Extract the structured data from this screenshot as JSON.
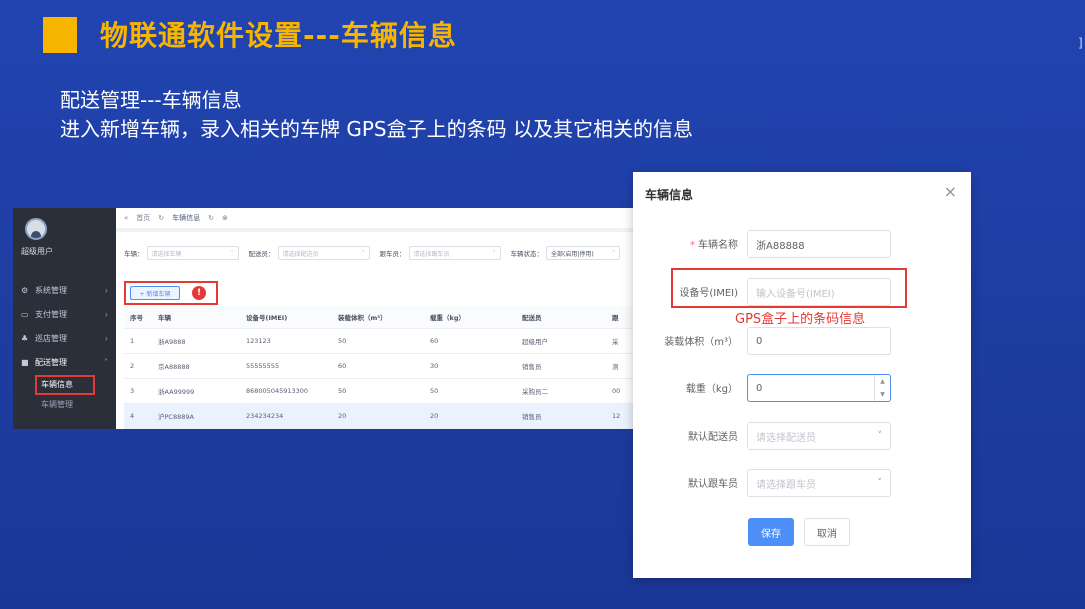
{
  "slide": {
    "title": "物联通软件设置---车辆信息",
    "line1": "配送管理---车辆信息",
    "line2": "进入新增车辆，录入相关的车牌   GPS盒子上的条码  以及其它相关的信息",
    "edge_mark": "]",
    "accent_color": "#f7b500",
    "background_color": "#1f3fa8"
  },
  "admin": {
    "user_name": "超级用户",
    "topbar": {
      "collapse_icon": "double-chevron-left-icon",
      "home_tab": "首页",
      "active_tab": "车辆信息"
    },
    "menu": [
      {
        "icon": "gear-icon",
        "label": "系统管理"
      },
      {
        "icon": "card-icon",
        "label": "支付管理"
      },
      {
        "icon": "tree-icon",
        "label": "巡店管理"
      },
      {
        "icon": "truck-icon",
        "label": "配送管理"
      }
    ],
    "submenu": [
      {
        "label": "车辆信息"
      },
      {
        "label": "车辆管理"
      }
    ],
    "filters": {
      "vehicle_label": "车辆：",
      "vehicle_ph": "请选择车辆",
      "dispatcher_label": "配送员：",
      "dispatcher_ph": "请选择配送员",
      "follower_label": "跟车员：",
      "follower_ph": "请选择跟车员",
      "status_label": "车辆状态：",
      "status_value": "全部(启用|停用)"
    },
    "add_button": "+ 新增车辆",
    "alert_icon": "!",
    "table": {
      "headers": [
        "序号",
        "车辆",
        "设备号(IMEI)",
        "装载体积（m³）",
        "载重（kg）",
        "配送员",
        "跟"
      ],
      "rows": [
        [
          "1",
          "浙A9888",
          "123123",
          "50",
          "60",
          "超级用户",
          "采"
        ],
        [
          "2",
          "京A88888",
          "55555555",
          "60",
          "30",
          "销售员",
          "测"
        ],
        [
          "3",
          "浙AA99999",
          "868005045913300",
          "50",
          "50",
          "采购员二",
          "00"
        ],
        [
          "4",
          "沪PC8889A",
          "234234234",
          "20",
          "20",
          "销售员",
          "12"
        ]
      ]
    }
  },
  "dialog": {
    "title": "车辆信息",
    "close": "×",
    "fields": {
      "name_label": "车辆名称",
      "name_value": "浙A88888",
      "imei_label": "设备号(IMEI)",
      "imei_ph": "输入设备号(IMEI)",
      "volume_label": "装载体积（m³）",
      "volume_value": "0",
      "weight_label": "载重（kg）",
      "weight_value": "0",
      "dispatcher_label": "默认配送员",
      "dispatcher_ph": "请选择配送员",
      "follower_label": "默认跟车员",
      "follower_ph": "请选择跟车员"
    },
    "annotation": "GPS盒子上的条码信息",
    "save": "保存",
    "cancel": "取消"
  }
}
